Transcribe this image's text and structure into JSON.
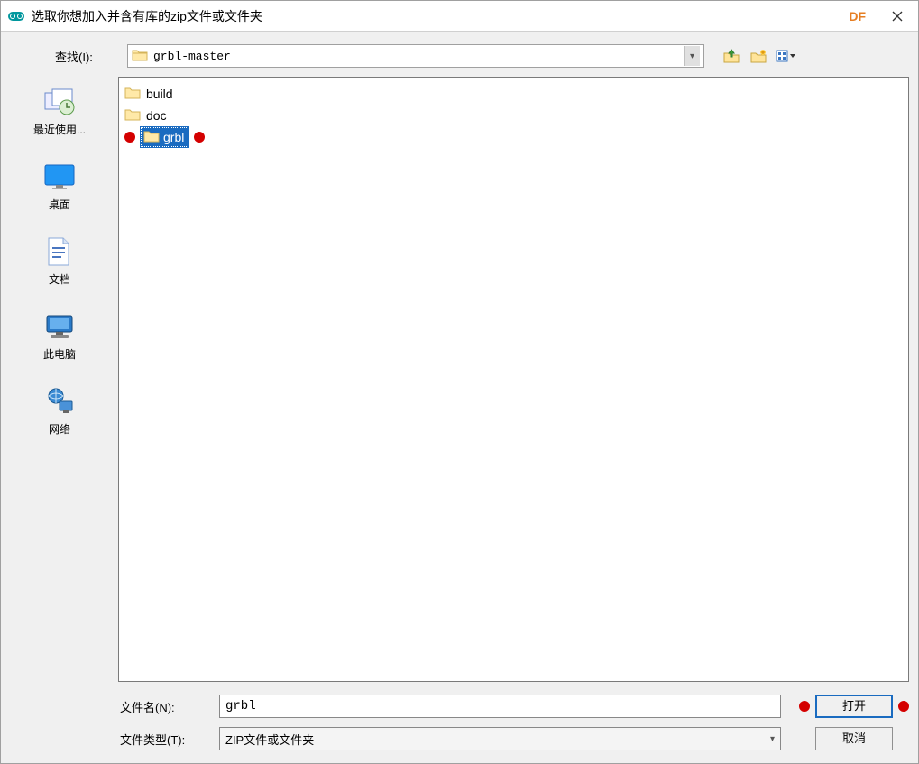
{
  "titlebar": {
    "title": "选取你想加入并含有库的zip文件或文件夹",
    "brand": "DF"
  },
  "lookin": {
    "label": "查找(I):",
    "current": "grbl-master"
  },
  "places": {
    "recent": "最近使用...",
    "desktop": "桌面",
    "documents": "文档",
    "thispc": "此电脑",
    "network": "网络"
  },
  "files": [
    {
      "name": "build",
      "selected": false
    },
    {
      "name": "doc",
      "selected": false
    },
    {
      "name": "grbl",
      "selected": true
    }
  ],
  "filename": {
    "label": "文件名(N):",
    "value": "grbl"
  },
  "filetype": {
    "label": "文件类型(T):",
    "value": "ZIP文件或文件夹"
  },
  "buttons": {
    "open": "打开",
    "cancel": "取消"
  },
  "icons": {
    "up": "folder-up-icon",
    "newfolder": "new-folder-icon",
    "viewmenu": "view-menu-icon"
  }
}
